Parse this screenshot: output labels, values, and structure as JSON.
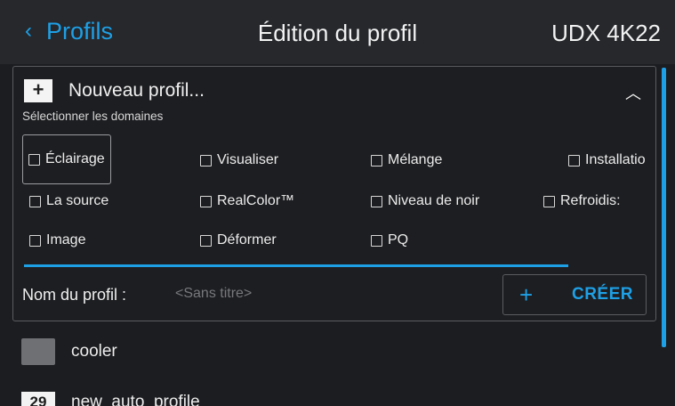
{
  "header": {
    "back_label": "Profils",
    "back_icon": "chevron-left-icon",
    "title": "Édition du profil",
    "device": "UDX 4K22"
  },
  "new_profile": {
    "plus_symbol": "+",
    "label": "Nouveau profil...",
    "collapse_icon": "chevron-up-icon",
    "domains_label": "Sélectionner les domaines",
    "domains": [
      {
        "label": "Éclairage",
        "checked": false
      },
      {
        "label": "Visualiser",
        "checked": false
      },
      {
        "label": "Mélange",
        "checked": false
      },
      {
        "label": "Installatio",
        "checked": false
      },
      {
        "label": "La source",
        "checked": false
      },
      {
        "label": "RealColor™",
        "checked": false
      },
      {
        "label": "Niveau de noir",
        "checked": false
      },
      {
        "label": "Refroidis:",
        "checked": false
      },
      {
        "label": "Image",
        "checked": false
      },
      {
        "label": "Déformer",
        "checked": false
      },
      {
        "label": "PQ",
        "checked": false
      }
    ],
    "name_label": "Nom du profil :",
    "name_placeholder": "<Sans titre>",
    "create_plus": "+",
    "create_label": "CRÉER"
  },
  "profiles": [
    {
      "name": "cooler",
      "thumb": "swatch"
    },
    {
      "name": "new_auto_profile",
      "thumb": "29"
    }
  ],
  "colors": {
    "accent": "#1ea0e6",
    "background": "#1c1d20",
    "header": "#26282c"
  }
}
